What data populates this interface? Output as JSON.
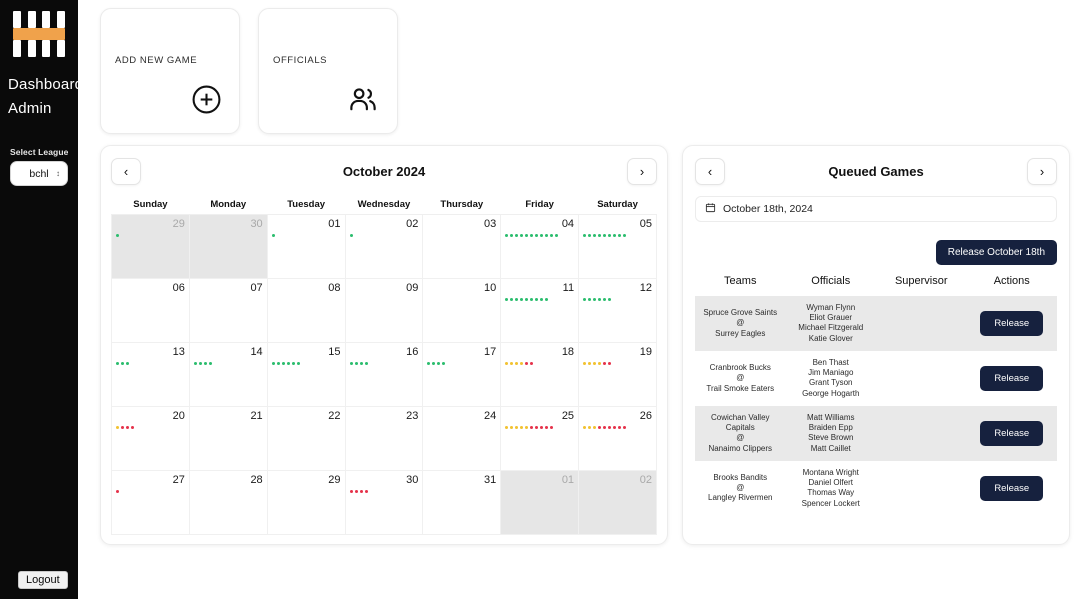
{
  "sidebar": {
    "logo_name": "striped-logo",
    "nav": [
      {
        "label": "Dashboard",
        "name": "sidebar-item-dashboard"
      },
      {
        "label": "Admin",
        "name": "sidebar-item-admin"
      }
    ],
    "select_league_label": "Select League",
    "league_value": "bchl",
    "logout_label": "Logout"
  },
  "action_cards": [
    {
      "label": "ADD NEW GAME",
      "icon": "plus-circle-icon"
    },
    {
      "label": "OFFICIALS",
      "icon": "people-group-icon"
    }
  ],
  "calendar": {
    "title": "October 2024",
    "prev_label": "‹",
    "next_label": "›",
    "weekdays": [
      "Sunday",
      "Monday",
      "Tuesday",
      "Wednesday",
      "Thursday",
      "Friday",
      "Saturday"
    ],
    "weeks": [
      [
        {
          "day": "29",
          "other": true,
          "green": 1,
          "yellow": 0,
          "red": 0
        },
        {
          "day": "30",
          "other": true,
          "green": 0,
          "yellow": 0,
          "red": 0
        },
        {
          "day": "01",
          "other": false,
          "green": 1,
          "yellow": 0,
          "red": 0
        },
        {
          "day": "02",
          "other": false,
          "green": 1,
          "yellow": 0,
          "red": 0
        },
        {
          "day": "03",
          "other": false,
          "green": 0,
          "yellow": 0,
          "red": 0
        },
        {
          "day": "04",
          "other": false,
          "green": 11,
          "yellow": 0,
          "red": 0
        },
        {
          "day": "05",
          "other": false,
          "green": 9,
          "yellow": 0,
          "red": 0
        }
      ],
      [
        {
          "day": "06",
          "other": false,
          "green": 0,
          "yellow": 0,
          "red": 0
        },
        {
          "day": "07",
          "other": false,
          "green": 0,
          "yellow": 0,
          "red": 0
        },
        {
          "day": "08",
          "other": false,
          "green": 0,
          "yellow": 0,
          "red": 0
        },
        {
          "day": "09",
          "other": false,
          "green": 0,
          "yellow": 0,
          "red": 0
        },
        {
          "day": "10",
          "other": false,
          "green": 0,
          "yellow": 0,
          "red": 0
        },
        {
          "day": "11",
          "other": false,
          "green": 9,
          "yellow": 0,
          "red": 0
        },
        {
          "day": "12",
          "other": false,
          "green": 6,
          "yellow": 0,
          "red": 0
        }
      ],
      [
        {
          "day": "13",
          "other": false,
          "green": 3,
          "yellow": 0,
          "red": 0
        },
        {
          "day": "14",
          "other": false,
          "green": 4,
          "yellow": 0,
          "red": 0
        },
        {
          "day": "15",
          "other": false,
          "green": 6,
          "yellow": 0,
          "red": 0
        },
        {
          "day": "16",
          "other": false,
          "green": 4,
          "yellow": 0,
          "red": 0
        },
        {
          "day": "17",
          "other": false,
          "green": 4,
          "yellow": 0,
          "red": 0
        },
        {
          "day": "18",
          "other": false,
          "green": 0,
          "yellow": 4,
          "red": 2
        },
        {
          "day": "19",
          "other": false,
          "green": 0,
          "yellow": 4,
          "red": 2
        }
      ],
      [
        {
          "day": "20",
          "other": false,
          "green": 0,
          "yellow": 1,
          "red": 3
        },
        {
          "day": "21",
          "other": false,
          "green": 0,
          "yellow": 0,
          "red": 0
        },
        {
          "day": "22",
          "other": false,
          "green": 0,
          "yellow": 0,
          "red": 0
        },
        {
          "day": "23",
          "other": false,
          "green": 0,
          "yellow": 0,
          "red": 0
        },
        {
          "day": "24",
          "other": false,
          "green": 0,
          "yellow": 0,
          "red": 0
        },
        {
          "day": "25",
          "other": false,
          "green": 0,
          "yellow": 5,
          "red": 5
        },
        {
          "day": "26",
          "other": false,
          "green": 0,
          "yellow": 3,
          "red": 6
        }
      ],
      [
        {
          "day": "27",
          "other": false,
          "green": 0,
          "yellow": 0,
          "red": 1
        },
        {
          "day": "28",
          "other": false,
          "green": 0,
          "yellow": 0,
          "red": 0
        },
        {
          "day": "29",
          "other": false,
          "green": 0,
          "yellow": 0,
          "red": 0
        },
        {
          "day": "30",
          "other": false,
          "green": 0,
          "yellow": 0,
          "red": 4
        },
        {
          "day": "31",
          "other": false,
          "green": 0,
          "yellow": 0,
          "red": 0
        },
        {
          "day": "01",
          "other": true,
          "green": 0,
          "yellow": 0,
          "red": 0
        },
        {
          "day": "02",
          "other": true,
          "green": 0,
          "yellow": 0,
          "red": 0
        }
      ]
    ]
  },
  "queued": {
    "title": "Queued Games",
    "prev_label": "‹",
    "next_label": "›",
    "date_value": "October 18th, 2024",
    "release_all_label": "Release October 18th",
    "columns": [
      "Teams",
      "Officials",
      "Supervisor",
      "Actions"
    ],
    "rows": [
      {
        "teams": "Spruce Grove Saints\n@\nSurrey Eagles",
        "officials": "Wyman Flynn\nEliot Grauer\nMichael Fitzgerald\nKatie Glover",
        "supervisor": "",
        "action_label": "Release"
      },
      {
        "teams": "Cranbrook Bucks\n@\nTrail Smoke Eaters",
        "officials": "Ben Thast\nJim Maniago\nGrant Tyson\nGeorge Hogarth",
        "supervisor": "",
        "action_label": "Release"
      },
      {
        "teams": "Cowichan Valley Capitals\n@\nNanaimo Clippers",
        "officials": "Matt Williams\nBraiden Epp\nSteve Brown\nMatt Caillet",
        "supervisor": "",
        "action_label": "Release"
      },
      {
        "teams": "Brooks Bandits\n@\nLangley Rivermen",
        "officials": "Montana Wright\nDaniel Olfert\nThomas Way\nSpencer Lockert",
        "supervisor": "",
        "action_label": "Release"
      }
    ]
  },
  "colors": {
    "sidebar_bg": "#0a0a0a",
    "accent_orange": "#f0a24b",
    "dark_button": "#16213e",
    "dot_green": "#2bbd6e",
    "dot_yellow": "#f2c230",
    "dot_red": "#e5324a"
  }
}
